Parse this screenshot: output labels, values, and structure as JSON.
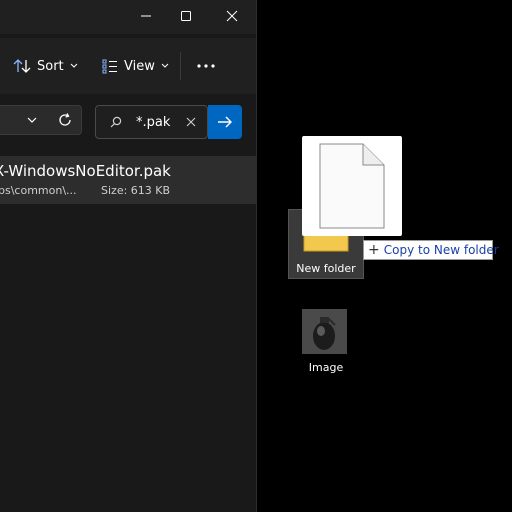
{
  "window": {
    "toolbar": {
      "sort_label": "Sort",
      "view_label": "View"
    },
    "search": {
      "value": "*.pak"
    },
    "results": [
      {
        "name": "X-WindowsNoEditor.pak",
        "path": "ps\\common\\...",
        "size": "Size: 613 KB"
      }
    ]
  },
  "desktop": {
    "folder_label": "New folder",
    "drag_tooltip": "Copy to New folder",
    "image_label": "Image"
  },
  "colors": {
    "accent": "#0067c0",
    "tooltip_text": "#1a3fa8",
    "folder": "#f2c94c"
  }
}
